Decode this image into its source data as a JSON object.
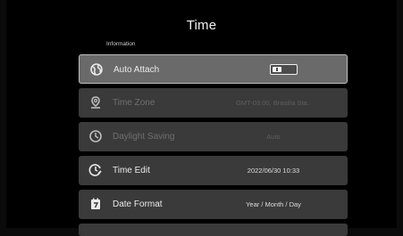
{
  "header": {
    "title": "Time"
  },
  "section": {
    "label": "Information"
  },
  "rows": [
    {
      "label": "Auto Attach",
      "value": "",
      "icon": "globe-icon",
      "state": "selected",
      "toggle_on": false
    },
    {
      "label": "Time Zone",
      "value": "GMT-03:00, Brasilia Sta..",
      "icon": "location-pin-icon",
      "state": "disabled"
    },
    {
      "label": "Daylight Saving",
      "value": "Auto",
      "icon": "clock-icon",
      "state": "disabled"
    },
    {
      "label": "Time Edit",
      "value": "2022/06/30 10:33",
      "icon": "clock-edit-icon",
      "state": "enabled"
    },
    {
      "label": "Date Format",
      "value": "Year / Month / Day",
      "icon": "calendar-icon",
      "state": "enabled"
    }
  ],
  "colors": {
    "background": "#000000",
    "row": "#3a3a3a",
    "row_selected": "#6a6a6a"
  }
}
